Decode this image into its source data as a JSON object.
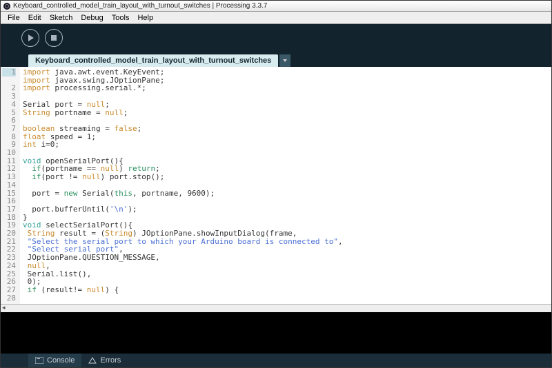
{
  "title": "Keyboard_controlled_model_train_layout_with_turnout_switches | Processing 3.3.7",
  "menu": [
    "File",
    "Edit",
    "Sketch",
    "Debug",
    "Tools",
    "Help"
  ],
  "tab": "Keyboard_controlled_model_train_layout_with_turnout_switches",
  "footer": {
    "console": "Console",
    "errors": "Errors"
  },
  "code": {
    "lines": [
      {
        "n": 1,
        "hl": true,
        "seg": [
          {
            "c": "kw-import",
            "t": "import"
          },
          {
            "t": " java.awt.event.KeyEvent;"
          }
        ]
      },
      {
        "n": 2,
        "seg": [
          {
            "c": "kw-import",
            "t": "import"
          },
          {
            "t": " javax.swing.JOptionPane;"
          }
        ]
      },
      {
        "n": 3,
        "seg": [
          {
            "c": "kw-import",
            "t": "import"
          },
          {
            "t": " processing.serial.*;"
          }
        ]
      },
      {
        "n": 4,
        "seg": []
      },
      {
        "n": 5,
        "seg": [
          {
            "t": "Serial port = "
          },
          {
            "c": "kw-lit",
            "t": "null"
          },
          {
            "t": ";"
          }
        ]
      },
      {
        "n": 6,
        "seg": [
          {
            "c": "kw-type",
            "t": "String"
          },
          {
            "t": " portname = "
          },
          {
            "c": "kw-lit",
            "t": "null"
          },
          {
            "t": ";"
          }
        ]
      },
      {
        "n": 7,
        "seg": []
      },
      {
        "n": 8,
        "seg": [
          {
            "c": "kw-type",
            "t": "boolean"
          },
          {
            "t": " streaming = "
          },
          {
            "c": "kw-lit",
            "t": "false"
          },
          {
            "t": ";"
          }
        ]
      },
      {
        "n": 9,
        "seg": [
          {
            "c": "kw-type",
            "t": "float"
          },
          {
            "t": " speed = 1;"
          }
        ]
      },
      {
        "n": 10,
        "seg": [
          {
            "c": "kw-type",
            "t": "int"
          },
          {
            "t": " i=0;"
          }
        ]
      },
      {
        "n": 11,
        "seg": []
      },
      {
        "n": 12,
        "seg": [
          {
            "c": "kw-decl",
            "t": "void"
          },
          {
            "t": " openSerialPort(){"
          }
        ]
      },
      {
        "n": 13,
        "seg": [
          {
            "t": "  "
          },
          {
            "c": "kw-flow",
            "t": "if"
          },
          {
            "t": "(portname == "
          },
          {
            "c": "kw-lit",
            "t": "null"
          },
          {
            "t": ") "
          },
          {
            "c": "kw-flow",
            "t": "return"
          },
          {
            "t": ";"
          }
        ]
      },
      {
        "n": 14,
        "seg": [
          {
            "t": "  "
          },
          {
            "c": "kw-flow",
            "t": "if"
          },
          {
            "t": "(port != "
          },
          {
            "c": "kw-lit",
            "t": "null"
          },
          {
            "t": ") port.stop();"
          }
        ]
      },
      {
        "n": 15,
        "seg": []
      },
      {
        "n": 16,
        "seg": [
          {
            "t": "  port = "
          },
          {
            "c": "kw-flow",
            "t": "new"
          },
          {
            "t": " Serial("
          },
          {
            "c": "kw-this",
            "t": "this"
          },
          {
            "t": ", portname, 9600);"
          }
        ]
      },
      {
        "n": 17,
        "seg": []
      },
      {
        "n": 18,
        "seg": [
          {
            "t": "  port.bufferUntil("
          },
          {
            "c": "str",
            "t": "'\\n'"
          },
          {
            "t": ");"
          }
        ]
      },
      {
        "n": 19,
        "seg": [
          {
            "t": "}"
          }
        ]
      },
      {
        "n": 20,
        "seg": [
          {
            "c": "kw-decl",
            "t": "void"
          },
          {
            "t": " selectSerialPort(){"
          }
        ]
      },
      {
        "n": 21,
        "seg": [
          {
            "t": " "
          },
          {
            "c": "kw-type",
            "t": "String"
          },
          {
            "t": " result = ("
          },
          {
            "c": "kw-type",
            "t": "String"
          },
          {
            "t": ") JOptionPane.showInputDialog(frame,"
          }
        ]
      },
      {
        "n": 22,
        "seg": [
          {
            "t": " "
          },
          {
            "c": "str",
            "t": "\"Select the serial port to which your Arduino board is connected to\""
          },
          {
            "t": ","
          }
        ]
      },
      {
        "n": 23,
        "seg": [
          {
            "t": " "
          },
          {
            "c": "str",
            "t": "\"Select serial port\""
          },
          {
            "t": ","
          }
        ]
      },
      {
        "n": 24,
        "seg": [
          {
            "t": " JOptionPane.QUESTION_MESSAGE,"
          }
        ]
      },
      {
        "n": 25,
        "seg": [
          {
            "t": " "
          },
          {
            "c": "kw-lit",
            "t": "null"
          },
          {
            "t": ","
          }
        ]
      },
      {
        "n": 26,
        "seg": [
          {
            "t": " Serial.list(),"
          }
        ]
      },
      {
        "n": 27,
        "seg": [
          {
            "t": " 0);"
          }
        ]
      },
      {
        "n": 28,
        "seg": [
          {
            "t": " "
          },
          {
            "c": "kw-flow",
            "t": "if"
          },
          {
            "t": " (result!= "
          },
          {
            "c": "kw-lit",
            "t": "null"
          },
          {
            "t": ") {"
          }
        ]
      }
    ]
  }
}
